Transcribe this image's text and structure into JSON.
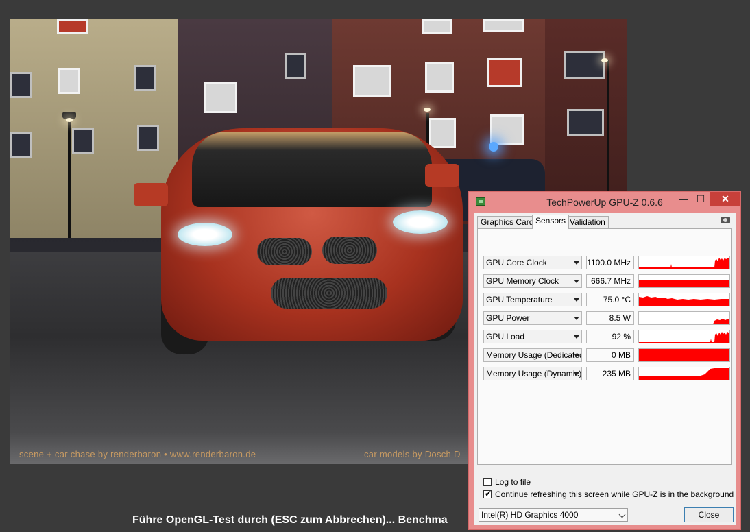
{
  "background_app": {
    "credit_left": "scene + car chase by renderbaron • www.renderbaron.de",
    "credit_right": "car models by Dosch D",
    "status_text": "Führe OpenGL-Test durch (ESC zum Abbrechen)... Benchma"
  },
  "gpuz": {
    "title": "TechPowerUp GPU-Z 0.6.6",
    "caption_buttons": {
      "minimize": "—",
      "maximize": "☐",
      "close": "✕"
    },
    "tabs": [
      {
        "label": "Graphics Card",
        "active": false
      },
      {
        "label": "Sensors",
        "active": true
      },
      {
        "label": "Validation",
        "active": false
      }
    ],
    "sensors": [
      {
        "name": "GPU Core Clock",
        "value": "1100.0 MHz"
      },
      {
        "name": "GPU Memory Clock",
        "value": "666.7 MHz"
      },
      {
        "name": "GPU Temperature",
        "value": "75.0 °C"
      },
      {
        "name": "GPU Power",
        "value": "8.5 W"
      },
      {
        "name": "GPU Load",
        "value": "92 %"
      },
      {
        "name": "Memory Usage (Dedicated)",
        "value": "0 MB"
      },
      {
        "name": "Memory Usage (Dynamic)",
        "value": "235 MB"
      }
    ],
    "log_to_file": {
      "label": "Log to file",
      "checked": false
    },
    "continue_refresh": {
      "label": "Continue refreshing this screen while GPU-Z is in the background",
      "checked": true
    },
    "gpu_select": "Intel(R) HD Graphics 4000",
    "close_label": "Close",
    "graph_color": "#ff0000",
    "window_color": "#e88d8d"
  }
}
